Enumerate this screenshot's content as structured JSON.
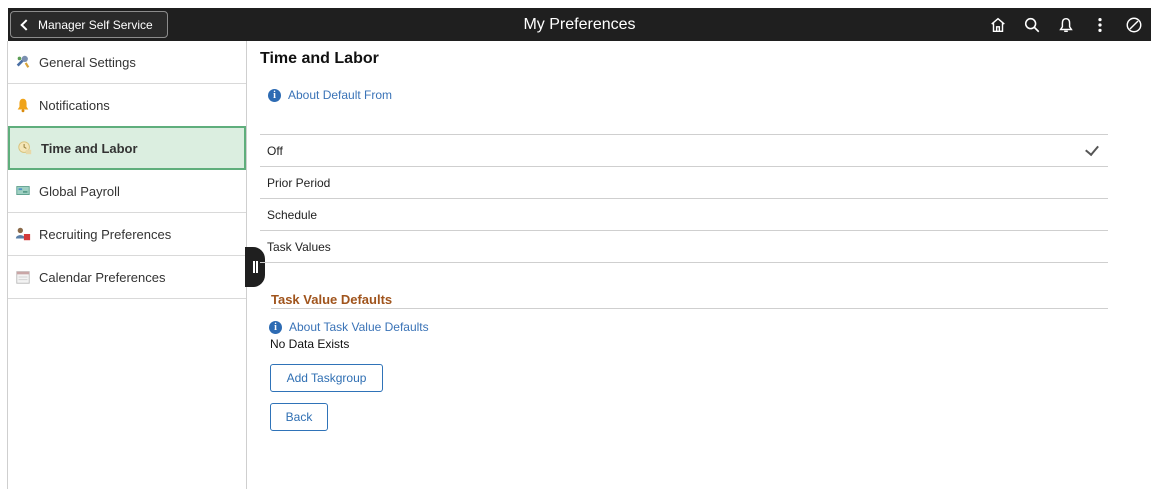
{
  "banner": {
    "back_label": "Manager Self Service",
    "title": "My Preferences",
    "icons": [
      "home-icon",
      "search-icon",
      "notification-bell-icon",
      "actions-menu-icon",
      "navbar-compass-icon"
    ]
  },
  "sidebar": {
    "items": [
      {
        "label": "General Settings",
        "icon": "wrench-icon"
      },
      {
        "label": "Notifications",
        "icon": "bell-icon"
      },
      {
        "label": "Time and Labor",
        "icon": "clock-icon"
      },
      {
        "label": "Global Payroll",
        "icon": "payroll-icon"
      },
      {
        "label": "Recruiting Preferences",
        "icon": "recruiting-icon"
      },
      {
        "label": "Calendar Preferences",
        "icon": "calendar-icon"
      }
    ],
    "selected_index": 2
  },
  "main": {
    "title": "Time and Labor",
    "about_default_link": "About Default From",
    "options": [
      {
        "label": "Off",
        "checked": true
      },
      {
        "label": "Prior Period",
        "checked": false
      },
      {
        "label": "Schedule",
        "checked": false
      },
      {
        "label": "Task Values",
        "checked": false
      }
    ],
    "task_defaults": {
      "heading": "Task Value Defaults",
      "about_link": "About Task Value Defaults",
      "empty_text": "No Data Exists",
      "add_button": "Add Taskgroup"
    },
    "back_button": "Back"
  },
  "colors": {
    "banner_bg": "#1f1f1f",
    "selected_bg": "#dbeee0",
    "selected_border": "#5fae7c",
    "link": "#3a73b7",
    "section_heading": "#a0541c"
  }
}
